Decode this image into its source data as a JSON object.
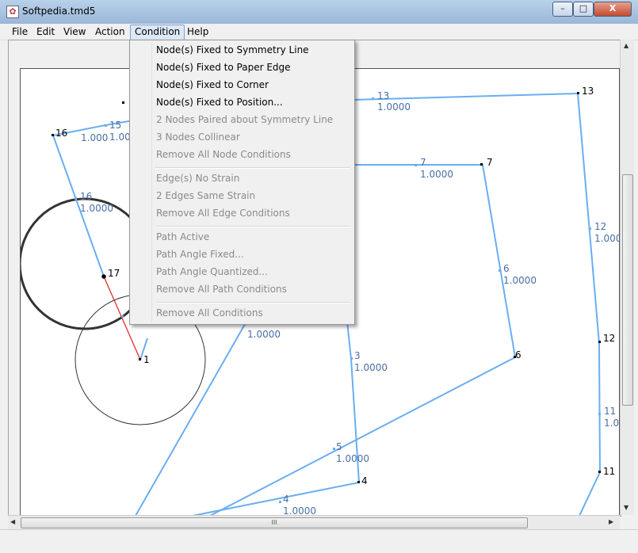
{
  "window": {
    "title": "Softpedia.tmd5",
    "minimize": "–",
    "maximize": "□",
    "close": "X"
  },
  "menubar": {
    "items": [
      "File",
      "Edit",
      "View",
      "Action",
      "Condition",
      "Help"
    ],
    "active": "Condition"
  },
  "condition_menu": {
    "items": [
      {
        "label": "Node(s) Fixed to Symmetry Line",
        "enabled": true
      },
      {
        "label": "Node(s) Fixed to Paper Edge",
        "enabled": true
      },
      {
        "label": "Node(s) Fixed to Corner",
        "enabled": true
      },
      {
        "label": "Node(s) Fixed to Position...",
        "enabled": true
      },
      {
        "label": "2 Nodes Paired about Symmetry Line",
        "enabled": false
      },
      {
        "label": "3 Nodes Collinear",
        "enabled": false
      },
      {
        "label": "Remove All Node Conditions",
        "enabled": false
      },
      {
        "label": "Edge(s) No Strain",
        "enabled": false
      },
      {
        "label": "2 Edges Same Strain",
        "enabled": false
      },
      {
        "label": "Remove All Edge Conditions",
        "enabled": false
      },
      {
        "label": "Path Active",
        "enabled": false
      },
      {
        "label": "Path Angle Fixed...",
        "enabled": false
      },
      {
        "label": "Path Angle Quantized...",
        "enabled": false
      },
      {
        "label": "Remove All Path Conditions",
        "enabled": false
      },
      {
        "label": "Remove All Conditions",
        "enabled": false
      }
    ]
  },
  "diagram": {
    "node_labels": [
      "1",
      "3",
      "4",
      "5",
      "6",
      "6",
      "7",
      "7",
      "11",
      "11",
      "12",
      "12",
      "13",
      "13",
      "15",
      "16",
      "16",
      "17",
      "4"
    ],
    "edge_values": [
      "1.0000",
      "1.0000",
      "1.0000",
      "1.0000",
      "1.0000",
      "1.0000",
      "1.0000",
      "1.0000",
      "1.0000",
      "1.000",
      "1.00",
      "1.000"
    ]
  },
  "colors": {
    "edge": "#6aaef0",
    "node_text": "#4a6fa5",
    "red_edge": "#e02020",
    "circle": "#333333"
  },
  "scrollbar": {
    "h_grip": "III"
  }
}
